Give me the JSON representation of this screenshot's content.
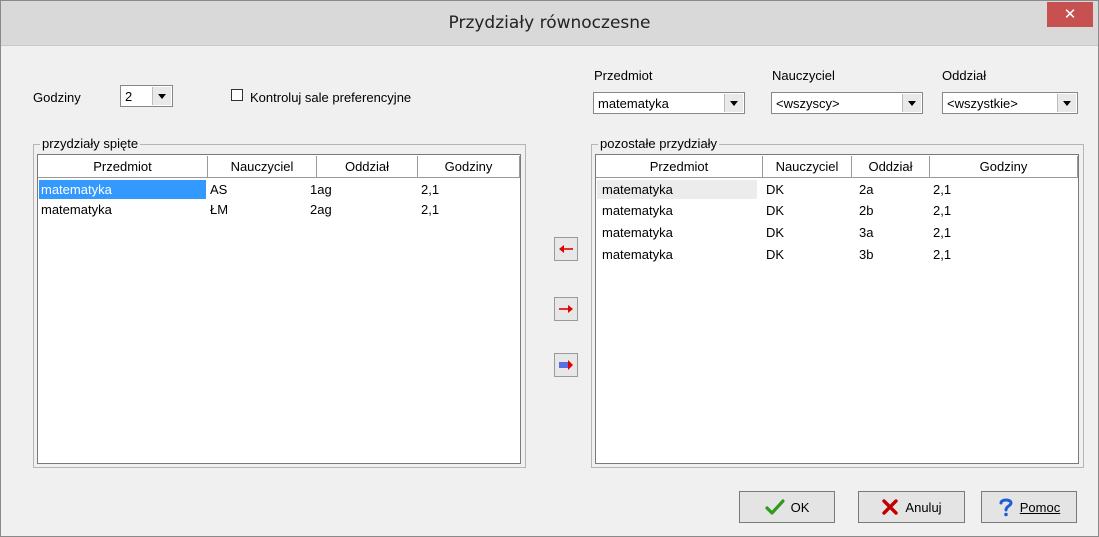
{
  "window": {
    "title": "Przydziały równoczesne",
    "close_glyph": "✕"
  },
  "top": {
    "hours_label": "Godziny",
    "hours_value": "2",
    "check_label": "Kontroluj sale preferencyjne",
    "check_checked": false
  },
  "filters": {
    "subject": {
      "label": "Przedmiot",
      "value": "matematyka"
    },
    "teacher": {
      "label": "Nauczyciel",
      "value": "<wszyscy>"
    },
    "class": {
      "label": "Oddział",
      "value": "<wszystkie>"
    }
  },
  "left_group": {
    "title": "przydziały spięte",
    "columns": [
      "Przedmiot",
      "Nauczyciel",
      "Oddział",
      "Godziny"
    ],
    "rows": [
      [
        "matematyka",
        "AS",
        "1ag",
        "2,1"
      ],
      [
        "matematyka",
        "ŁM",
        "2ag",
        "2,1"
      ]
    ]
  },
  "right_group": {
    "title": "pozostałe przydziały",
    "columns": [
      "Przedmiot",
      "Nauczyciel",
      "Oddział",
      "Godziny"
    ],
    "rows": [
      [
        "matematyka",
        "DK",
        "2a",
        "2,1"
      ],
      [
        "matematyka",
        "DK",
        "2b",
        "2,1"
      ],
      [
        "matematyka",
        "DK",
        "3a",
        "2,1"
      ],
      [
        "matematyka",
        "DK",
        "3b",
        "2,1"
      ]
    ]
  },
  "buttons": {
    "ok": "OK",
    "cancel": "Anuluj",
    "help": "Pomoc"
  },
  "icons": {
    "move_left": "arrow-left-icon",
    "move_right": "arrow-right-icon",
    "move_all_right": "move-all-right-icon",
    "ok": "check-icon",
    "cancel": "cross-icon",
    "help": "question-icon"
  },
  "colors": {
    "selection": "#3399ff",
    "close": "#c75050",
    "arrow_red": "#e00000",
    "arrow_blue": "#1a3cdc",
    "check_green": "#2f9a1b",
    "cross_red": "#c00000",
    "help_blue": "#1f5fd6"
  }
}
